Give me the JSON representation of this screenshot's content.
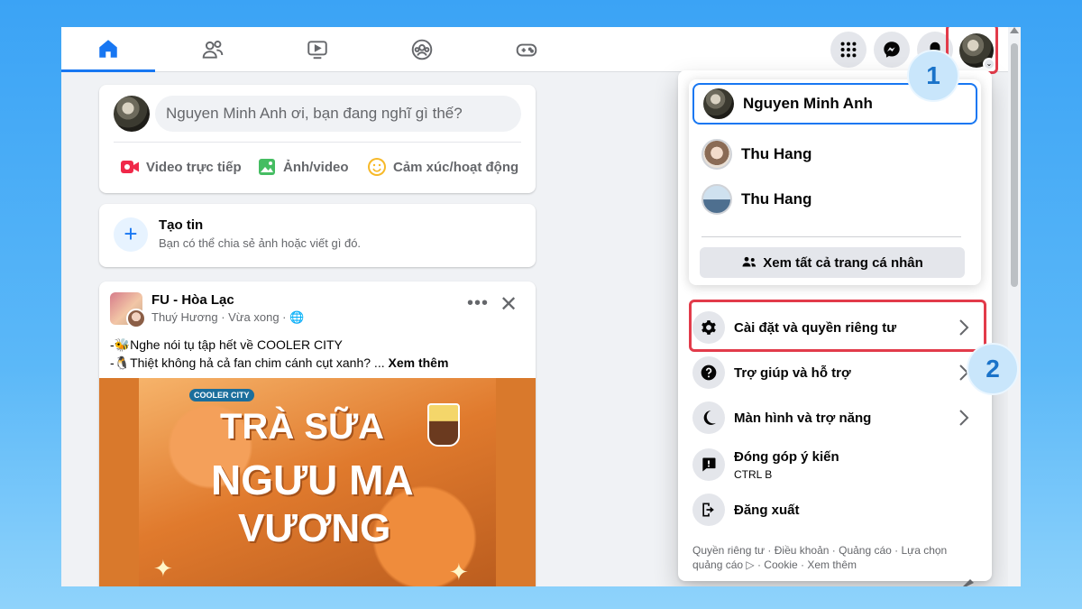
{
  "nav": {
    "tabs": [
      {
        "icon": "home-icon",
        "active": true
      },
      {
        "icon": "friends-icon",
        "active": false
      },
      {
        "icon": "watch-icon",
        "active": false
      },
      {
        "icon": "groups-icon",
        "active": false
      },
      {
        "icon": "gaming-icon",
        "active": false
      }
    ],
    "right_buttons": [
      "menu-grid-icon",
      "messenger-icon",
      "notifications-icon"
    ],
    "accent_color": "#1877f2"
  },
  "composer": {
    "placeholder": "Nguyen Minh Anh ơi, bạn đang nghĩ gì thế?",
    "actions": [
      {
        "label": "Video trực tiếp",
        "icon": "live-video-icon",
        "color": "#f02849"
      },
      {
        "label": "Ảnh/video",
        "icon": "photo-video-icon",
        "color": "#45bd62"
      },
      {
        "label": "Cảm xúc/hoạt động",
        "icon": "feeling-icon",
        "color": "#f7b928"
      }
    ]
  },
  "story": {
    "plus": "+",
    "title": "Tạo tin",
    "subtitle": "Bạn có thể chia sẻ ảnh hoặc viết gì đó."
  },
  "post": {
    "page_name": "FU - Hòa Lạc",
    "meta": "Thuý Hương · Vừa xong · 🌐",
    "more": "•••",
    "close": "✕",
    "line1": "-🐝Nghe nói tụ tập hết về COOLER CITY",
    "line2": "-🐧Thiệt không hả cả fan chim cánh cụt xanh? ... ",
    "see_more": "Xem thêm",
    "image": {
      "brand": "COOLER CITY",
      "line1": "TRÀ SỮA",
      "line2": "NGƯU MA",
      "line3": "VƯƠNG"
    }
  },
  "menu": {
    "profiles": [
      {
        "name": "Nguyen Minh Anh",
        "current": true
      },
      {
        "name": "Thu Hang",
        "current": false
      },
      {
        "name": "Thu Hang",
        "current": false
      }
    ],
    "see_all": "Xem tất cả trang cá nhân",
    "items": [
      {
        "label": "Cài đặt và quyền riêng tư",
        "icon": "gear-icon",
        "chevron": true,
        "sub": ""
      },
      {
        "label": "Trợ giúp và hỗ trợ",
        "icon": "help-icon",
        "chevron": true,
        "sub": ""
      },
      {
        "label": "Màn hình và trợ năng",
        "icon": "moon-icon",
        "chevron": true,
        "sub": ""
      },
      {
        "label": "Đóng góp ý kiến",
        "icon": "feedback-icon",
        "chevron": false,
        "sub": "CTRL B"
      },
      {
        "label": "Đăng xuất",
        "icon": "logout-icon",
        "chevron": false,
        "sub": ""
      }
    ],
    "footer_line1": "Quyền riêng tư · Điều khoản · Quảng cáo · Lựa chọn",
    "footer_line2_a": "quảng cáo",
    "footer_line2_b": " · Cookie · Xem thêm"
  },
  "annotations": {
    "step1": "1",
    "step2": "2",
    "highlight_color": "#e23b4a"
  }
}
